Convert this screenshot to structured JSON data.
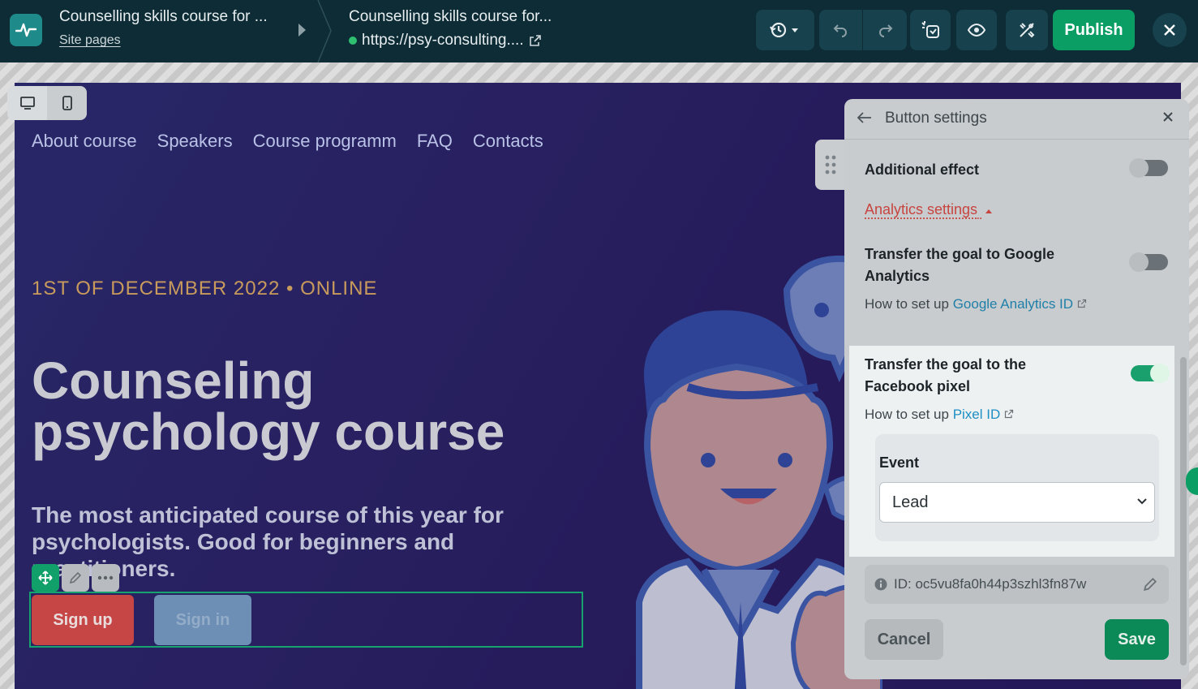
{
  "topbar": {
    "site_name": "Counselling skills course for ...",
    "site_pages_label": "Site pages",
    "page_title": "Counselling skills course for...",
    "page_url": "https://psy-consulting....",
    "publish_label": "Publish",
    "icons": [
      "history-icon",
      "undo-icon",
      "redo-icon",
      "ai-assistant-icon",
      "preview-eye-icon",
      "tools-icon",
      "close-icon"
    ]
  },
  "site": {
    "nav": [
      "About course",
      "Speakers",
      "Course programm",
      "FAQ",
      "Contacts"
    ],
    "date_line": "1ST OF DECEMBER 2022 • ONLINE",
    "title_line1": "Counseling",
    "title_line2": "psychology course",
    "subtitle": "The most anticipated course of this year for psychologists. Good for beginners and practitioners.",
    "signup_label": "Sign up",
    "signin_label": "Sign in"
  },
  "panel": {
    "title": "Button settings",
    "additional_effect_label": "Additional effect",
    "additional_effect_on": false,
    "analytics_link": "Analytics settings",
    "ga_label": "Transfer the goal to Google Analytics",
    "ga_on": false,
    "ga_howto_prefix": "How to set up",
    "ga_howto_link": "Google Analytics ID",
    "fb_label": "Transfer the goal to the Facebook pixel",
    "fb_on": true,
    "fb_howto_prefix": "How to set up",
    "fb_howto_link": "Pixel ID",
    "event_label": "Event",
    "event_value": "Lead",
    "id_text": "ID: oc5vu8fa0h44p3szhl3fn87w",
    "cancel_label": "Cancel",
    "save_label": "Save"
  },
  "colors": {
    "topbar_bg": "#0d2c36",
    "publish_green": "#0b9e64",
    "accent_red": "#c7443f",
    "link_blue": "#1f7fa8",
    "date_gold": "#c89b5c"
  }
}
